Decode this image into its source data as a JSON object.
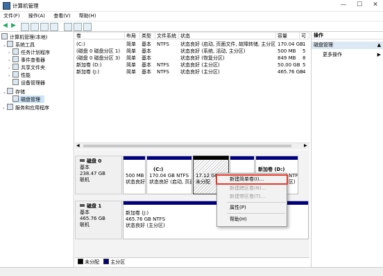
{
  "window": {
    "title": "计算机管理",
    "min": "—",
    "max": "☐",
    "close": "✕"
  },
  "menu": [
    "文件(F)",
    "操作(A)",
    "查看(V)",
    "帮助(H)"
  ],
  "tree": [
    {
      "label": "计算机管理(本地)"
    },
    {
      "label": "系统工具"
    },
    {
      "label": "任务计划程序"
    },
    {
      "label": "事件查看器"
    },
    {
      "label": "共享文件夹"
    },
    {
      "label": "性能"
    },
    {
      "label": "设备管理器"
    },
    {
      "label": "存储"
    },
    {
      "label": "磁盘管理"
    },
    {
      "label": "服务和应用程序"
    }
  ],
  "columns": [
    "卷",
    "布局",
    "类型",
    "文件系统",
    "状态",
    "容量",
    "可"
  ],
  "volumes": [
    {
      "name": "(C:)",
      "layout": "简单",
      "type": "基本",
      "fs": "NTFS",
      "status": "状态良好 (启动, 页面文件, 故障转储, 主分区)",
      "cap": "170.04 GB",
      "free": "1"
    },
    {
      "name": "(磁盘 0 磁盘分区 1)",
      "layout": "简单",
      "type": "基本",
      "fs": "",
      "status": "状态良好 (系统, 活动, 主分区)",
      "cap": "500 MB",
      "free": "5"
    },
    {
      "name": "(磁盘 0 磁盘分区 3)",
      "layout": "简单",
      "type": "基本",
      "fs": "",
      "status": "状态良好 (恢复分区)",
      "cap": "849 MB",
      "free": "8"
    },
    {
      "name": "新加卷 (D:)",
      "layout": "简单",
      "type": "基本",
      "fs": "NTFS",
      "status": "状态良好 (主分区)",
      "cap": "50.00 GB",
      "free": "5"
    },
    {
      "name": "新加卷 (J:)",
      "layout": "简单",
      "type": "基本",
      "fs": "NTFS",
      "status": "状态良好 (主分区)",
      "cap": "465.76 GB",
      "free": "4"
    }
  ],
  "disks": [
    {
      "name": "磁盘 0",
      "kind": "基本",
      "size": "238.47 GB",
      "state": "联机"
    },
    {
      "name": "磁盘 1",
      "kind": "基本",
      "size": "465.76 GB",
      "state": "联机"
    }
  ],
  "parts": {
    "d0p1": {
      "l1": "500 MB",
      "l2": "状态良好"
    },
    "d0c": {
      "name": "(C:)",
      "l1": "170.04 GB NTFS",
      "l2": "状态良好 (启动, 页面"
    },
    "d0u": {
      "l1": "17.12 GB",
      "l2": "未分配"
    },
    "d0d": {
      "name": "新加卷 (D:)",
      "l1": "NTFS",
      "l2": "区)"
    },
    "d1j": {
      "name": "新加卷 (J:)",
      "l1": "465.76 GB NTFS",
      "l2": "状态良好 (主分区)"
    }
  },
  "legend": {
    "unalloc": "未分配",
    "primary": "主分区"
  },
  "ops": {
    "header": "操作",
    "section": "磁盘管理",
    "more": "更多操作"
  },
  "context_menu": {
    "simple": "新建简单卷(I)...",
    "spanned": "新建跨区卷(N)...",
    "striped": "新建带区卷(T)...",
    "props": "属性(P)",
    "help": "帮助(H)"
  },
  "colors": {
    "primary": "#00007f",
    "highlight": "#e03b2a",
    "selected": "#cce4f7"
  }
}
